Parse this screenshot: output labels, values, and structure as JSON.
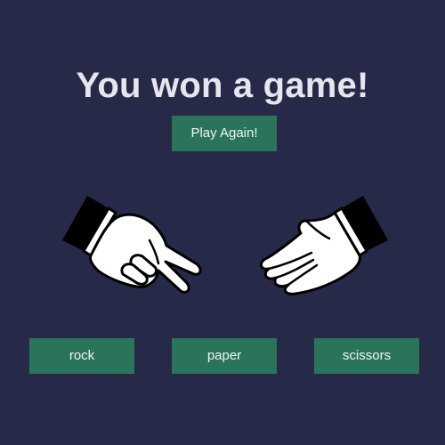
{
  "header": {
    "title": "You won a game!"
  },
  "actions": {
    "play_again_label": "Play Again!"
  },
  "hands": {
    "player": {
      "gesture": "scissors",
      "icon": "scissors-hand-icon"
    },
    "computer": {
      "gesture": "paper",
      "icon": "paper-hand-icon"
    }
  },
  "choices": [
    {
      "label": "rock"
    },
    {
      "label": "paper"
    },
    {
      "label": "scissors"
    }
  ],
  "colors": {
    "background": "#262948",
    "button": "#2a7559",
    "title": "#e6e6ec"
  }
}
